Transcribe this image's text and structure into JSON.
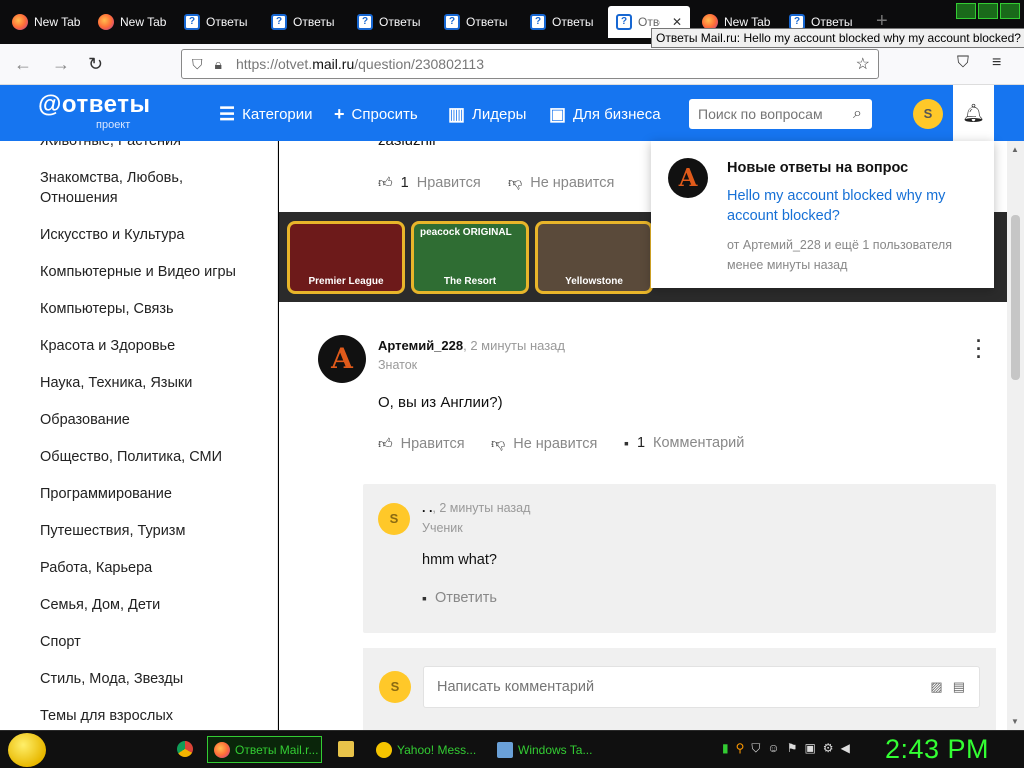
{
  "browser": {
    "tabs": [
      {
        "label": "New Tab",
        "icon": "firefox-icon"
      },
      {
        "label": "New Tab",
        "icon": "firefox-icon"
      },
      {
        "label": "Ответы",
        "icon": "question-icon"
      },
      {
        "label": "Ответы",
        "icon": "question-icon"
      },
      {
        "label": "Ответы",
        "icon": "question-icon"
      },
      {
        "label": "Ответы",
        "icon": "question-icon"
      },
      {
        "label": "Ответы",
        "icon": "question-icon"
      },
      {
        "label": "Ответы",
        "icon": "question-icon",
        "active": true
      },
      {
        "label": "New Tab",
        "icon": "firefox-icon"
      },
      {
        "label": "Ответы",
        "icon": "question-icon"
      }
    ],
    "tooltip": "Ответы Mail.ru: Hello my account blocked why my account blocked?",
    "url_prefix": "https://otvet.",
    "url_domain": "mail.ru",
    "url_path": "/question/230802113"
  },
  "site": {
    "logo": "@ответы",
    "logo_sub": "проект",
    "nav": [
      "Категории",
      "Спросить",
      "Лидеры",
      "Для бизнеса"
    ],
    "search_placeholder": "Поиск по вопросам",
    "user_initial": "S"
  },
  "sidebar": {
    "items": [
      "Животные, Растения",
      "Знакомства, Любовь, Отношения",
      "Искусство и Культура",
      "Компьютерные и Видео игры",
      "Компьютеры, Связь",
      "Красота и Здоровье",
      "Наука, Техника, Языки",
      "Образование",
      "Общество, Политика, СМИ",
      "Программирование",
      "Путешествия, Туризм",
      "Работа, Карьера",
      "Семья, Дом, Дети",
      "Спорт",
      "Стиль, Мода, Звезды",
      "Темы для взрослых"
    ]
  },
  "prev_answer": {
    "text_tail": "zasluzhil",
    "like_count": "1",
    "like_label": "Нравится",
    "dislike_label": "Не нравится"
  },
  "banner": {
    "cards": [
      {
        "title": "Premier League",
        "brand": ""
      },
      {
        "title": "The Resort",
        "brand": "peacock ORIGINAL"
      },
      {
        "title": "Yellowstone",
        "brand": ""
      }
    ]
  },
  "answer": {
    "author": "Артемий_228",
    "time": ", 2 минуты назад",
    "rank": "Знаток",
    "text": "О, вы из Англии?)",
    "like_label": "Нравится",
    "dislike_label": "Не нравится",
    "comment_count": "1",
    "comment_label": "Комментарий"
  },
  "comment": {
    "author": ". .",
    "time": ", 2 минуты назад",
    "rank": "Ученик",
    "text": "hmm what?",
    "reply_label": "Ответить",
    "avatar_initial": "S"
  },
  "reply": {
    "placeholder": "Написать комментарий",
    "avatar_initial": "S"
  },
  "notification": {
    "title": "Новые ответы на вопрос",
    "link": "Hello my account blocked why my account blocked?",
    "meta": "от Артемий_228 и ещё 1 пользователя менее минуты назад"
  },
  "taskbar": {
    "items": [
      {
        "label": "Ответы Mail.r...",
        "active": true
      },
      {
        "label": "Yahoo! Mess...",
        "active": false
      },
      {
        "label": "Windows Ta...",
        "active": false
      }
    ],
    "clock": "2:43 PM"
  }
}
